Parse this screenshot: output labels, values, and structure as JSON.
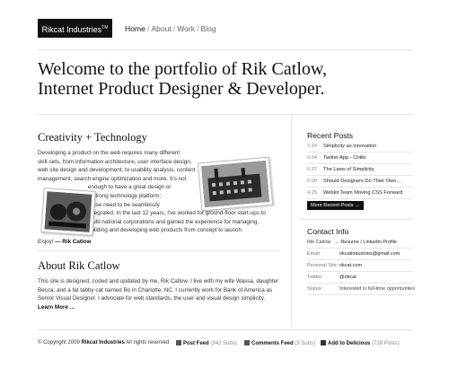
{
  "header": {
    "logo": "Rikcat Industries",
    "logo_mark": "TM",
    "nav": [
      "Home",
      "About",
      "Work",
      "Blog"
    ]
  },
  "headline": {
    "line1": "Welcome to the portfolio of Rik Catlow,",
    "line2": "Internet Product Designer & Developer."
  },
  "creativity": {
    "title": "Creativity + Technology",
    "lines": [
      "Developing a product on the web requires many different",
      "skill-sets, from information architecture, user interface design,",
      "web site design and development, to usability analysis, content",
      "management, search engine optimization and more. It's not",
      "enough to have a great design or",
      "a strong technology platform;",
      "these need to be seamlessly",
      "integrated. In the last 12 years, I've worked for ground-floor start-ups to",
      "multi-national corporations and gained the experience for managing,",
      "building and developing web products from concept to launch."
    ],
    "enjoy": "Enjoy!",
    "sign": "— Rik Catlow"
  },
  "about": {
    "title": "About Rik Catlow",
    "lines": [
      "This site is designed, coded and updated by me, Rik Catlow. I live with my wife Wassa, daughter",
      "Becca, and a fat tabby cat named Bo in Charlotte, NC. I currently work for Bank of America as",
      "Senior Visual Designer. I advocate for web standards, the user and visual design simplicity."
    ],
    "learn_more": "Learn More ..."
  },
  "recent": {
    "title": "Recent Posts",
    "posts": [
      {
        "date": "2.24",
        "title": "Simplicity as Innovation"
      },
      {
        "date": "9.04",
        "title": "Twitter App - Critikr"
      },
      {
        "date": "6.27",
        "title": "The Laws of Simplicity"
      },
      {
        "date": "6.09",
        "title": "Should Designers Do Their Own…"
      },
      {
        "date": "4.25",
        "title": "Webkit Team Moving CSS Forward"
      }
    ],
    "more_button": "More Recent Posts →"
  },
  "contact": {
    "title": "Contact Info",
    "name": "Rik Catlow",
    "profile_links": "→ Resume / Linkedin Profile",
    "rows": [
      {
        "label": "Email:",
        "value": "rikcatindustries@gmail.com"
      },
      {
        "label": "Personal Site:",
        "value": "rikcat.com"
      },
      {
        "label": "Twitter:",
        "value": "@rikcat"
      },
      {
        "label": "Status:",
        "value": "Interested in full-time opportunities"
      }
    ]
  },
  "footer": {
    "copyright_prefix": "© Copyright 2009",
    "company": "Rikcat Industries",
    "rights": "All rights reserved",
    "post_feed": "Post Feed",
    "post_feed_count": "(342 Subs)",
    "comments_feed": "Comments Feed",
    "comments_feed_count": "(3 Subs)",
    "delicious": "Add to Delicious",
    "delicious_count": "(728 Posts)"
  }
}
